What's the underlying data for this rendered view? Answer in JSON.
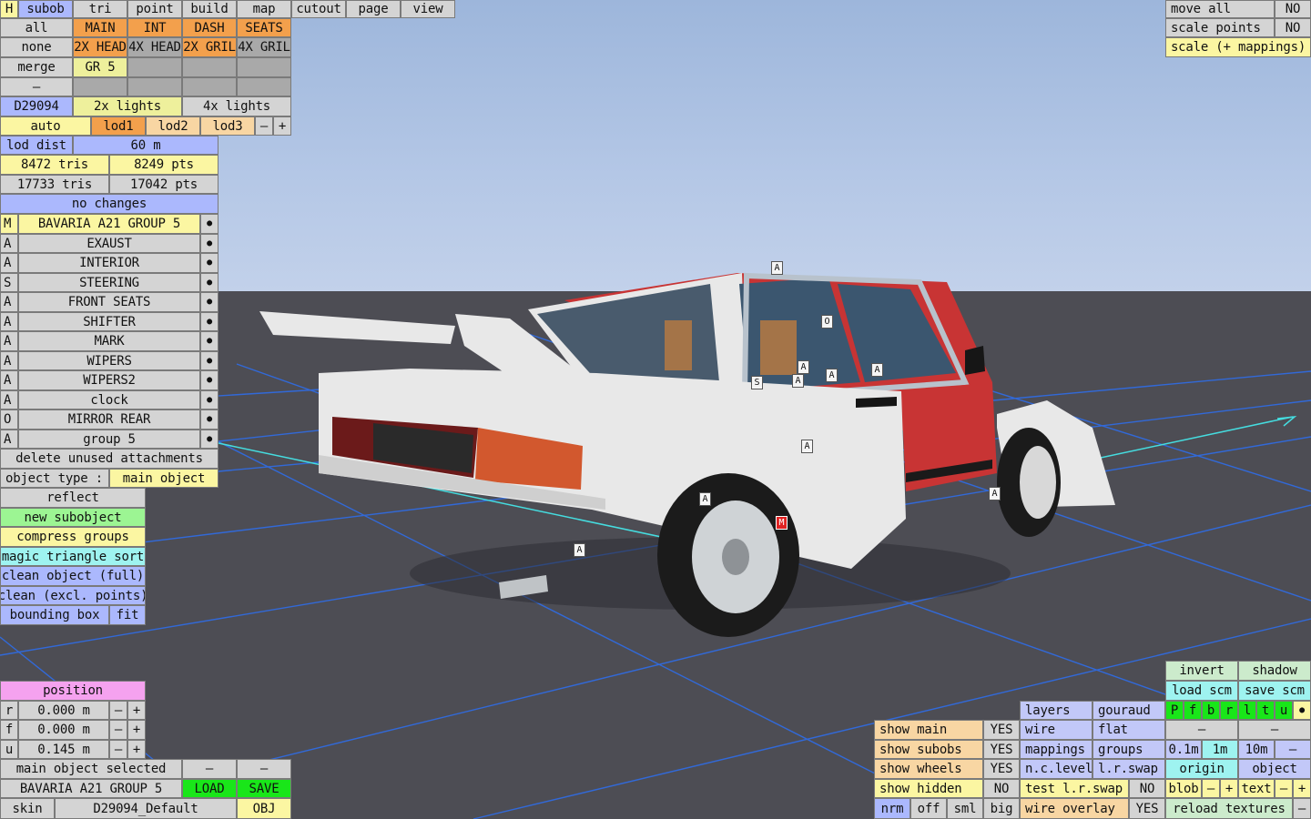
{
  "menu": {
    "items": [
      {
        "label": "H",
        "color": "ye"
      },
      {
        "label": "subob",
        "color": "bl"
      },
      {
        "label": "tri",
        "color": "g"
      },
      {
        "label": "point",
        "color": "g"
      },
      {
        "label": "build",
        "color": "g"
      },
      {
        "label": "map",
        "color": "g"
      },
      {
        "label": "cutout",
        "color": "g"
      },
      {
        "label": "page",
        "color": "g"
      },
      {
        "label": "view",
        "color": "g"
      }
    ]
  },
  "groups": {
    "all": "all",
    "none": "none",
    "merge": "merge",
    "dash": "–",
    "row1": [
      "MAIN",
      "INT",
      "DASH",
      "SEATS"
    ],
    "row2": [
      "2X HEAD",
      "4X HEAD",
      "2X GRIL",
      "4X GRIL"
    ],
    "row3": [
      "GR 5",
      "",
      "",
      ""
    ]
  },
  "lod": {
    "id": "D29094",
    "lights2": "2x lights",
    "lights4": "4x lights",
    "auto": "auto",
    "lod1": "lod1",
    "lod2": "lod2",
    "lod3": "lod3",
    "minus": "–",
    "plus": "+",
    "dist_label": "lod dist",
    "dist_value": "60 m",
    "tris1": "8472 tris",
    "pts1": "8249 pts",
    "tris2": "17733 tris",
    "pts2": "17042 pts",
    "changes": "no changes"
  },
  "subobjects": [
    {
      "tag": "M",
      "name": "BAVARIA A21 GROUP 5",
      "dot": "●"
    },
    {
      "tag": "A",
      "name": "EXAUST",
      "dot": "●"
    },
    {
      "tag": "A",
      "name": "INTERIOR",
      "dot": "●"
    },
    {
      "tag": "S",
      "name": "STEERING",
      "dot": "●"
    },
    {
      "tag": "A",
      "name": "FRONT SEATS",
      "dot": "●"
    },
    {
      "tag": "A",
      "name": "SHIFTER",
      "dot": "●"
    },
    {
      "tag": "A",
      "name": "MARK",
      "dot": "●"
    },
    {
      "tag": "A",
      "name": "WIPERS",
      "dot": "●"
    },
    {
      "tag": "A",
      "name": "WIPERS2",
      "dot": "●"
    },
    {
      "tag": "A",
      "name": "clock",
      "dot": "●"
    },
    {
      "tag": "O",
      "name": "MIRROR REAR",
      "dot": "●"
    },
    {
      "tag": "A",
      "name": "group 5",
      "dot": "●"
    }
  ],
  "tools": {
    "delete_unused": "delete unused attachments",
    "object_type_label": "object type :",
    "object_type_value": "main object",
    "reflect": "reflect",
    "new_subobject": "new subobject",
    "compress_groups": "compress groups",
    "magic_sort": "magic triangle sort",
    "clean_full": "clean object (full)",
    "clean_excl": "clean (excl. points)",
    "bounding_box": "bounding box",
    "fit": "fit"
  },
  "position": {
    "title": "position",
    "rows": [
      {
        "axis": "r",
        "value": "0.000 m",
        "minus": "–",
        "plus": "+"
      },
      {
        "axis": "f",
        "value": "0.000 m",
        "minus": "–",
        "plus": "+"
      },
      {
        "axis": "u",
        "value": "0.145 m",
        "minus": "–",
        "plus": "+"
      }
    ]
  },
  "bottom_left": {
    "main_selected": "main object selected",
    "dash1": "–",
    "dash2": "–",
    "car_name": "BAVARIA A21 GROUP 5",
    "load": "LOAD",
    "save": "SAVE",
    "skin_label": "skin",
    "skin_value": "D29094_Default",
    "obj": "OBJ"
  },
  "top_right": {
    "move_all": "move all",
    "move_all_val": "NO",
    "scale_points": "scale points",
    "scale_points_val": "NO",
    "scale_mappings": "scale (+ mappings)"
  },
  "show": {
    "main": "show main",
    "main_val": "YES",
    "subobs": "show subobs",
    "subobs_val": "YES",
    "wheels": "show wheels",
    "wheels_val": "YES",
    "hidden": "show hidden",
    "hidden_val": "NO",
    "nrm": "nrm",
    "off": "off",
    "sml": "sml",
    "big": "big"
  },
  "render": {
    "layers": "layers",
    "gouraud": "gouraud",
    "wire": "wire",
    "flat": "flat",
    "mappings": "mappings",
    "groups": "groups",
    "nc_level": "n.c.level",
    "lr_swap": "l.r.swap",
    "test_lr_swap": "test l.r.swap",
    "test_val": "NO",
    "wire_overlay": "wire overlay",
    "overlay_val": "YES"
  },
  "right_panel": {
    "invert": "invert",
    "shadow": "shadow",
    "load_scm": "load scm",
    "save_scm": "save scm",
    "letters": [
      "P",
      "f",
      "b",
      "r",
      "l",
      "t",
      "u",
      "●"
    ],
    "dash_a": "–",
    "dash_b": "–",
    "grid": [
      "0.1m",
      "1m",
      "10m",
      "–"
    ],
    "origin": "origin",
    "object": "object",
    "blob": "blob",
    "blob_minus": "–",
    "blob_plus": "+",
    "text": "text",
    "text_minus": "–",
    "text_plus": "+",
    "reload": "reload textures",
    "reload_dash": "–"
  },
  "markers": [
    "A",
    "O",
    "A",
    "S",
    "A",
    "A",
    "A",
    "A",
    "A",
    "A",
    "M",
    "A"
  ],
  "colors": {
    "sky": "#a8bfe2",
    "floor": "#4d4d54",
    "car_body": "#e8e8e8",
    "car_red": "#c83434",
    "grid_line": "#2f6de8",
    "axis": "#45dde0"
  }
}
